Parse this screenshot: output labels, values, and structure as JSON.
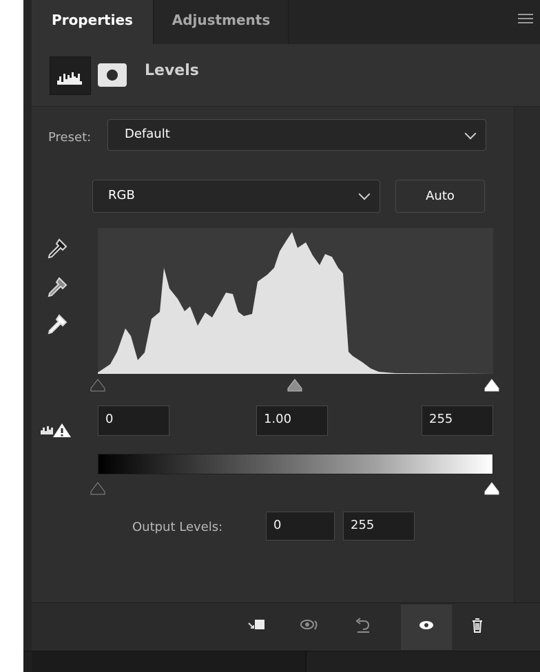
{
  "tabs": {
    "properties": "Properties",
    "adjustments": "Adjustments"
  },
  "header": {
    "title": "Levels",
    "icons": [
      "histogram-icon",
      "mask-icon"
    ]
  },
  "preset": {
    "label": "Preset:",
    "value": "Default"
  },
  "channel": {
    "value": "RGB"
  },
  "auto_label": "Auto",
  "input_levels": {
    "black": "0",
    "gamma": "1.00",
    "white": "255"
  },
  "output": {
    "label": "Output Levels:",
    "black": "0",
    "white": "255"
  },
  "footer_icons": [
    "clip-to-layer-icon",
    "view-previous-state-icon",
    "reset-icon",
    "visibility-icon",
    "delete-icon"
  ],
  "colors": {
    "panel": "#2f2f2f",
    "tab_bar": "#242424",
    "histogram_bg": "#3a3a3a",
    "histogram_fill": "#e1e1e1"
  }
}
